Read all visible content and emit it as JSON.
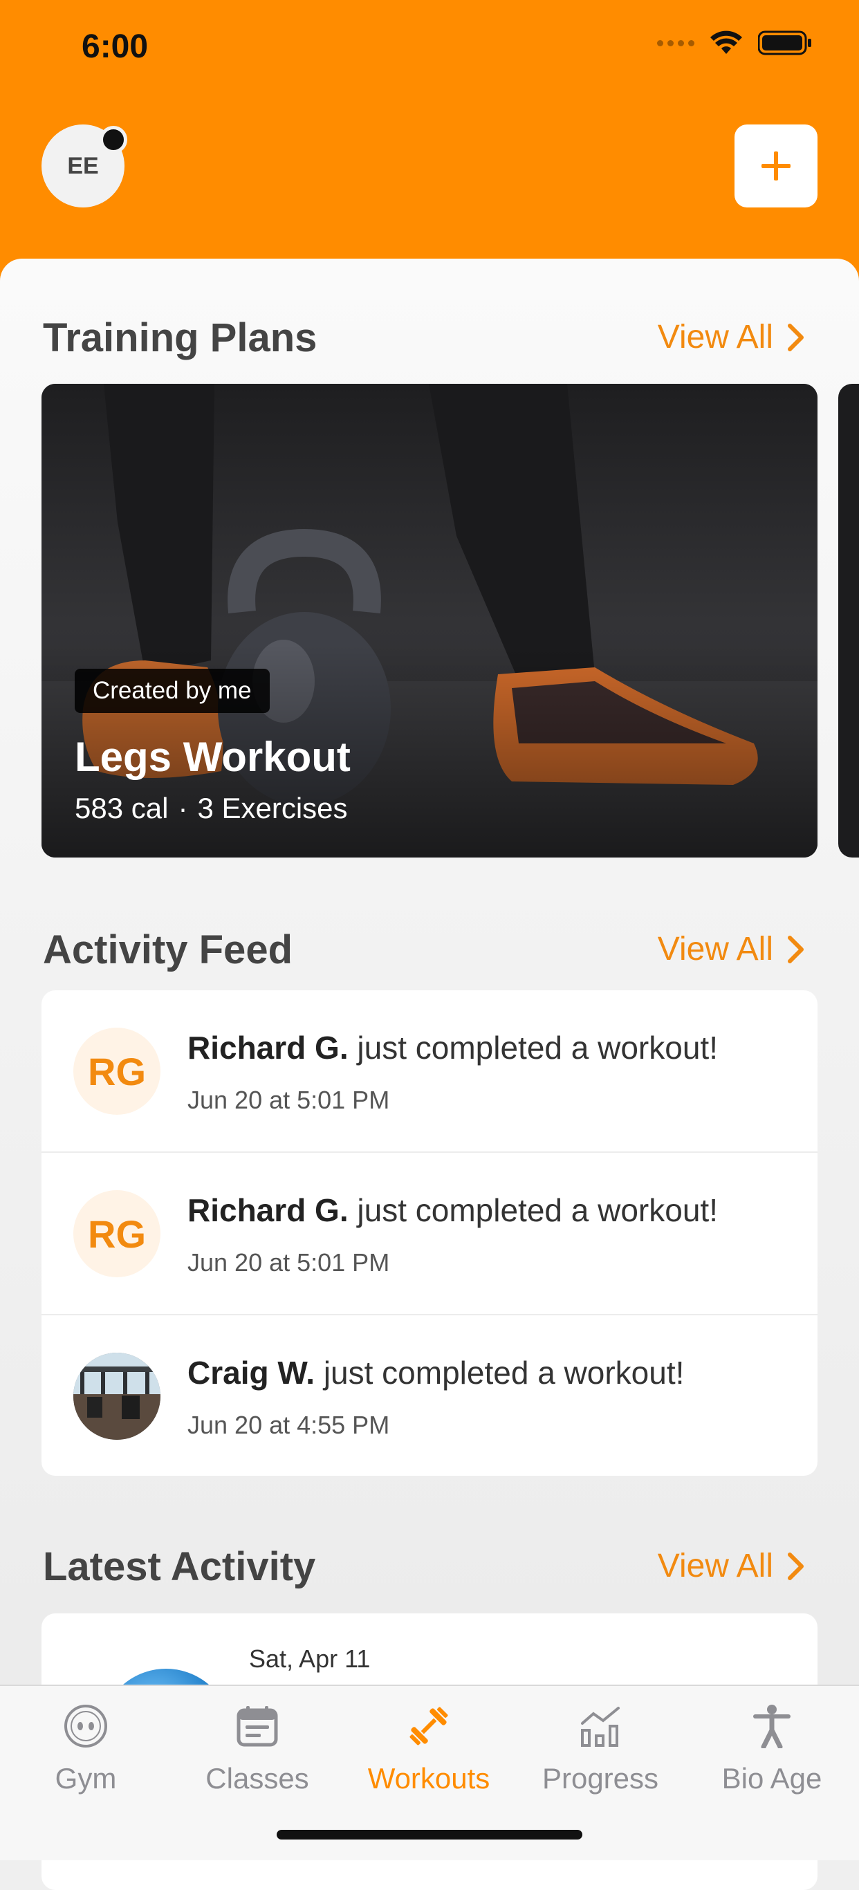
{
  "status_bar": {
    "time": "6:00"
  },
  "header": {
    "avatar_initials": "EE",
    "add_button_label": "+"
  },
  "training_plans": {
    "title": "Training Plans",
    "view_all": "View All",
    "card": {
      "tag": "Created by me",
      "title": "Legs Workout",
      "calories": "583 cal",
      "separator": "·",
      "exercises": "3 Exercises"
    }
  },
  "activity_feed": {
    "title": "Activity Feed",
    "view_all": "View All",
    "items": [
      {
        "initials": "RG",
        "name": "Richard G.",
        "action": "just completed a workout!",
        "time": "Jun 20 at 5:01 PM"
      },
      {
        "initials": "RG",
        "name": "Richard G.",
        "action": "just completed a workout!",
        "time": "Jun 20 at 5:01 PM"
      },
      {
        "initials": "",
        "name": "Craig W.",
        "action": "just completed a workout!",
        "time": "Jun 20 at 4:55 PM"
      }
    ]
  },
  "latest_activity": {
    "title": "Latest Activity",
    "view_all": "View All",
    "date": "Sat, Apr 11"
  },
  "tabbar": {
    "tabs": [
      {
        "label": "Gym",
        "icon": "gym-face-icon"
      },
      {
        "label": "Classes",
        "icon": "calendar-icon"
      },
      {
        "label": "Workouts",
        "icon": "dumbbell-icon",
        "active": true
      },
      {
        "label": "Progress",
        "icon": "chart-icon"
      },
      {
        "label": "Bio Age",
        "icon": "person-icon"
      }
    ]
  },
  "colors": {
    "accent": "#FF8C00",
    "link": "#F28A10",
    "inactive": "#8e8e93"
  }
}
